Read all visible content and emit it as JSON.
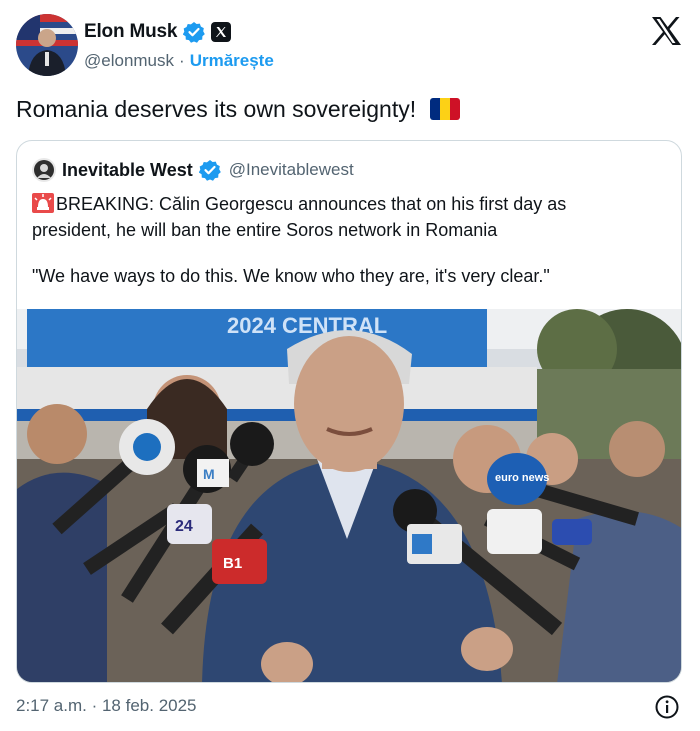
{
  "author": {
    "name": "Elon Musk",
    "handle": "@elonmusk",
    "separator": "·",
    "follow_label": "Urmărește",
    "verified": true,
    "avatar_icon": "profile-photo"
  },
  "tweet": {
    "text": "Romania deserves its own sovereignty!",
    "flag": "romanian-flag",
    "flag_colors": [
      "#002b7f",
      "#fcd116",
      "#ce1126"
    ]
  },
  "quoted": {
    "name": "Inevitable West",
    "handle": "@Inevitablewest",
    "lines": [
      "BREAKING: Călin Georgescu announces that on his first day as",
      "president, he will ban the entire Soros network in Romania",
      "\"We have ways to do this. We know who they are, it's very clear.\""
    ],
    "photo": {
      "banner_text": "2024   CENTRAL",
      "mic_labels": [
        "euro news",
        "24",
        "B1",
        "M"
      ]
    }
  },
  "footer": {
    "timestamp": "2:17 a.m. · 18 feb. 2025"
  },
  "colors": {
    "accent": "#1d9bf0",
    "muted": "#536471",
    "border": "#cfd9de"
  }
}
